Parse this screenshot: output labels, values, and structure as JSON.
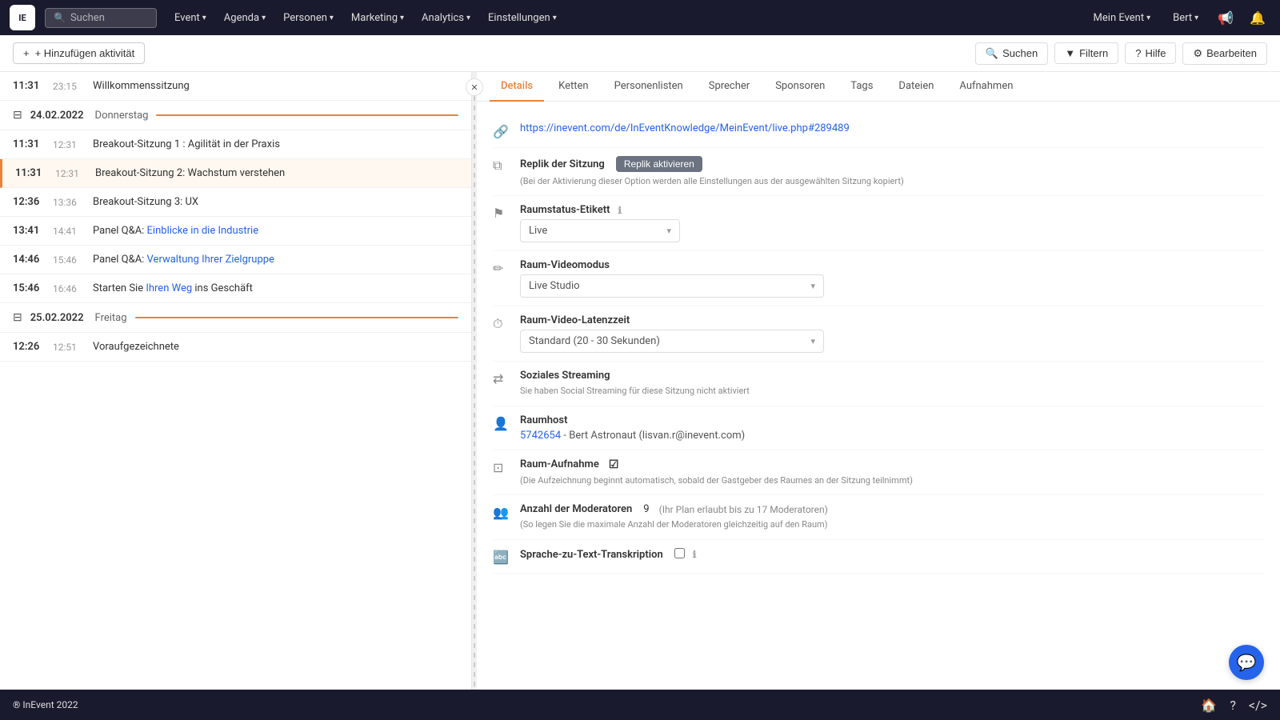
{
  "app": {
    "logo_text": "IE",
    "footer_brand": "® InEvent 2022"
  },
  "topnav": {
    "search_placeholder": "Suchen",
    "items": [
      {
        "label": "Event",
        "has_chevron": true
      },
      {
        "label": "Agenda",
        "has_chevron": true
      },
      {
        "label": "Personen",
        "has_chevron": true
      },
      {
        "label": "Marketing",
        "has_chevron": true
      },
      {
        "label": "Analytics",
        "has_chevron": true
      },
      {
        "label": "Einstellungen",
        "has_chevron": true
      }
    ],
    "right": [
      {
        "label": "Mein Event",
        "has_chevron": true
      },
      {
        "label": "Bert",
        "has_chevron": true
      }
    ]
  },
  "toolbar": {
    "add_label": "+ Hinzufügen aktivität",
    "search_label": "Suchen",
    "filter_label": "Filtern",
    "help_label": "Hilfe",
    "edit_label": "Bearbeiten"
  },
  "left_panel": {
    "first_item": {
      "time_start": "11:31",
      "time_end": "23:15",
      "title": "Willkommenssitzung"
    },
    "day1": {
      "date": "24.02.2022",
      "day_name": "Donnerstag"
    },
    "day1_items": [
      {
        "time_start": "11:31",
        "time_end": "12:31",
        "title": "Breakout-Sitzung 1 : Agilität in der Praxis",
        "highlighted": false
      },
      {
        "time_start": "11:31",
        "time_end": "12:31",
        "title": "Breakout-Sitzung 2: Wachstum verstehen",
        "highlighted": true
      },
      {
        "time_start": "12:36",
        "time_end": "13:36",
        "title": "Breakout-Sitzung 3: UX",
        "highlighted": false
      },
      {
        "time_start": "13:41",
        "time_end": "14:41",
        "title": "Panel Q&A: Einblicke in die Industrie",
        "highlighted": false
      },
      {
        "time_start": "14:46",
        "time_end": "15:46",
        "title": "Panel Q&A: Verwaltung Ihrer Zielgruppe",
        "highlighted": false
      },
      {
        "time_start": "15:46",
        "time_end": "16:46",
        "title": "Starten Sie Ihren Weg ins Geschäft",
        "highlighted": false
      }
    ],
    "day2": {
      "date": "25.02.2022",
      "day_name": "Freitag"
    },
    "day2_items": [
      {
        "time_start": "12:26",
        "time_end": "12:51",
        "title": "Voraufgezeichnete",
        "highlighted": false
      }
    ]
  },
  "right_panel": {
    "tabs": [
      {
        "label": "Details",
        "active": true
      },
      {
        "label": "Ketten",
        "active": false
      },
      {
        "label": "Personenlisten",
        "active": false
      },
      {
        "label": "Sprecher",
        "active": false
      },
      {
        "label": "Sponsoren",
        "active": false
      },
      {
        "label": "Tags",
        "active": false
      },
      {
        "label": "Dateien",
        "active": false
      },
      {
        "label": "Aufnahmen",
        "active": false
      }
    ],
    "fields": {
      "link": {
        "url": "https://inevent.com/de/InEventKnowledge/MeinEvent/live.php#289489"
      },
      "replica": {
        "label": "Replik der Sitzung",
        "button_label": "Replik aktivieren",
        "note": "(Bei der Aktivierung dieser Option werden alle Einstellungen aus der ausgewählten Sitzung kopiert)"
      },
      "room_status": {
        "label": "Raumstatus-Etikett",
        "value": "Live"
      },
      "room_video_mode": {
        "label": "Raum-Videomodus",
        "value": "Live Studio"
      },
      "room_latency": {
        "label": "Raum-Video-Latenzzeit",
        "value": "Standard (20 - 30 Sekunden)"
      },
      "social_streaming": {
        "label": "Soziales Streaming",
        "note": "Sie haben Social Streaming für diese Sitzung nicht aktiviert"
      },
      "room_host": {
        "label": "Raumhost",
        "host_id": "5742654",
        "host_name": "Bert Astronaut",
        "host_email": "lisvan.r@inevent.com"
      },
      "room_recording": {
        "label": "Raum-Aufnahme",
        "note": "(Die Aufzeichnung beginnt automatisch, sobald der Gastgeber des Raumes an der Sitzung teilnimmt)"
      },
      "moderators": {
        "label": "Anzahl der Moderatoren",
        "count": "9",
        "plan_note": "(Ihr Plan erlaubt bis zu 17 Moderatoren)",
        "note": "(So legen Sie die maximale Anzahl der Moderatoren gleichzeitig auf den Raum)"
      },
      "transcription": {
        "label": "Sprache-zu-Text-Transkription"
      }
    }
  }
}
